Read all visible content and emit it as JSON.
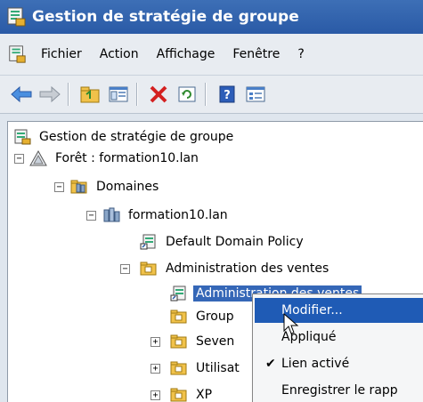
{
  "window": {
    "title": "Gestion de stratégie de groupe"
  },
  "menubar": {
    "items": [
      "Fichier",
      "Action",
      "Affichage",
      "Fenêtre",
      "?"
    ]
  },
  "toolbar": {
    "buttons": [
      "back-icon",
      "forward-icon",
      "up-folder-icon",
      "show-hide-tree-icon",
      "delete-icon",
      "refresh-icon",
      "help-icon",
      "properties-icon"
    ]
  },
  "tree": {
    "root": "Gestion de stratégie de groupe",
    "forest": "Forêt : formation10.lan",
    "domains": "Domaines",
    "domain": "formation10.lan",
    "default_policy": "Default Domain Policy",
    "ou_sales": "Administration des ventes",
    "gpo_link": "Administration des ventes",
    "group_partial": "Group",
    "seven_partial": "Seven",
    "users_partial": "Utilisat",
    "xp": "XP"
  },
  "context_menu": {
    "items": [
      {
        "label": "Modifier...",
        "highlighted": true,
        "checked": false
      },
      {
        "label": "Appliqué",
        "highlighted": false,
        "checked": false
      },
      {
        "label": "Lien activé",
        "highlighted": false,
        "checked": true
      },
      {
        "label": "Enregistrer le rapp",
        "highlighted": false,
        "checked": false
      }
    ]
  },
  "colors": {
    "titlebar": "#2a5aa6",
    "selection": "#3567b7",
    "menu_highlight": "#1f5bb5"
  }
}
